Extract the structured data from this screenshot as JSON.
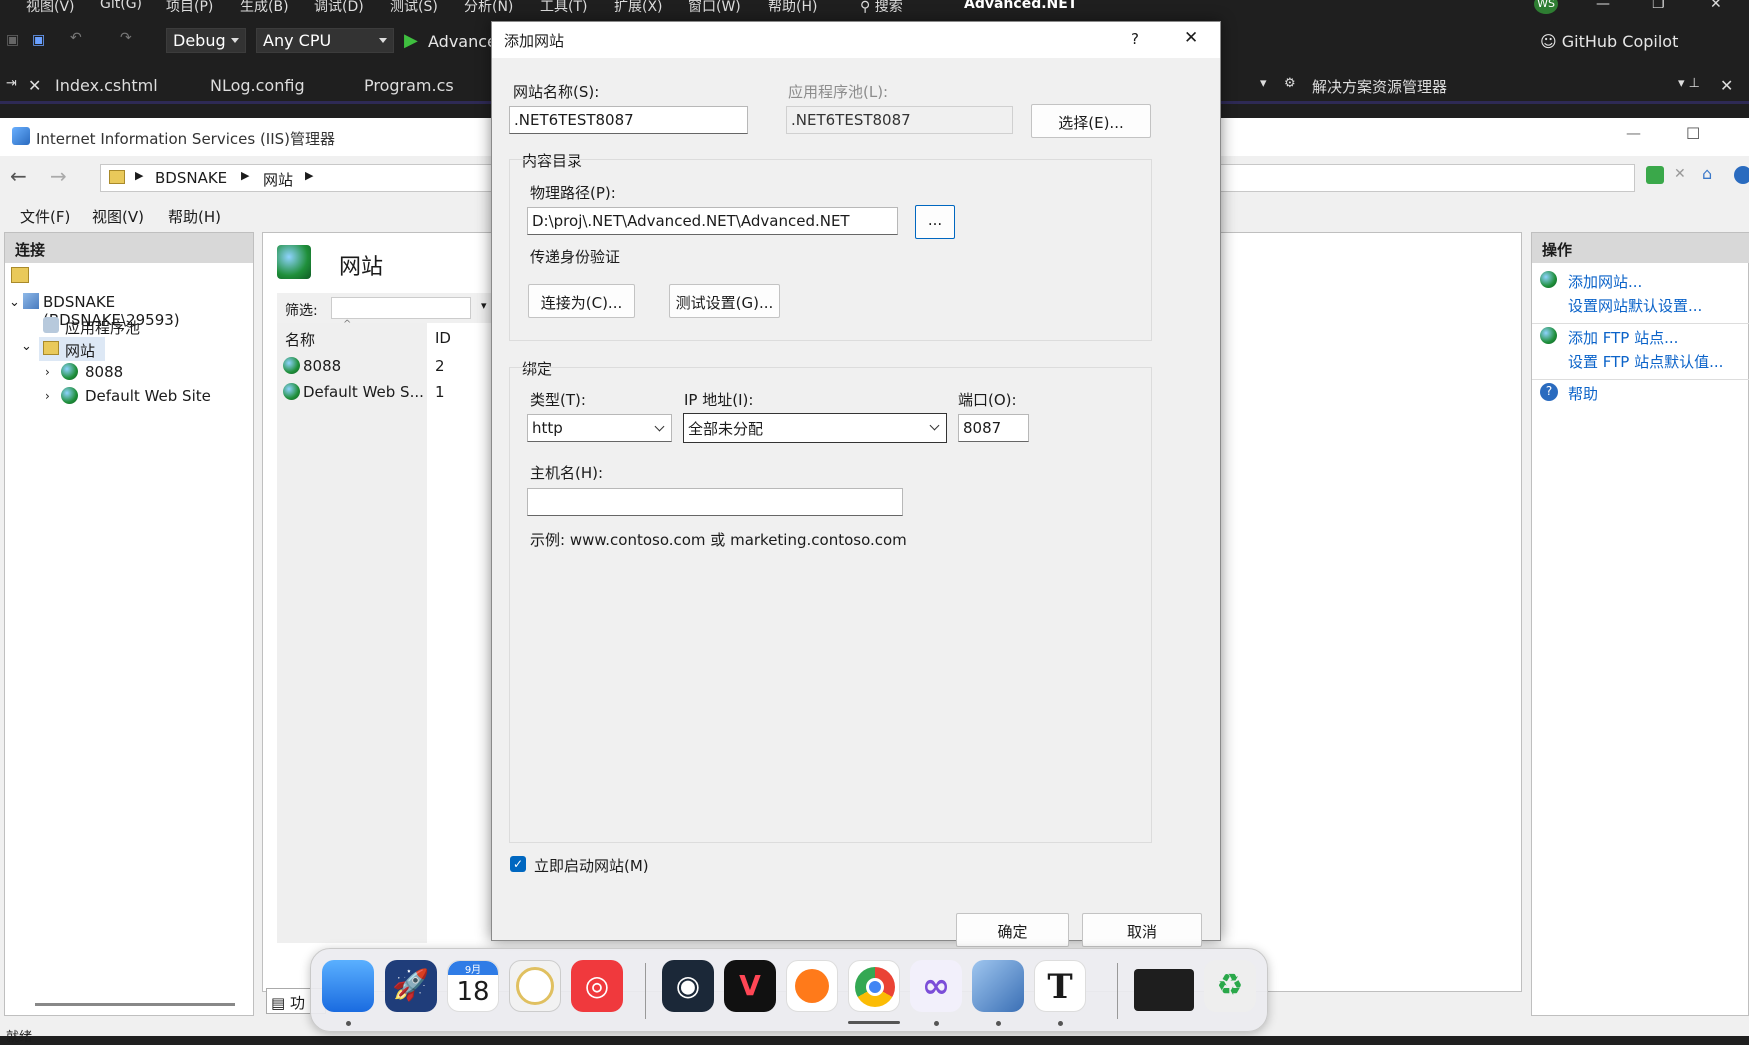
{
  "vs": {
    "menu": [
      "视图(V)",
      "Git(G)",
      "项目(P)",
      "生成(B)",
      "调试(D)",
      "测试(S)",
      "分析(N)",
      "工具(T)",
      "扩展(X)",
      "窗口(W)",
      "帮助(H)"
    ],
    "search": "搜索",
    "project_title": "Advanced.NET",
    "user_initials": "WS",
    "config": "Debug",
    "platform": "Any CPU",
    "run_label": "Advance",
    "copilot": "GitHub Copilot",
    "tabs": [
      "Index.cshtml",
      "NLog.config",
      "Program.cs"
    ],
    "solution_explorer": "解决方案资源管理器"
  },
  "iis": {
    "title": "Internet Information Services (IIS)管理器",
    "breadcrumb": [
      "BDSNAKE",
      "网站"
    ],
    "menu": [
      "文件(F)",
      "视图(V)",
      "帮助(H)"
    ],
    "connections_header": "连接",
    "tree": {
      "server": "BDSNAKE (BDSNAKE\\29593)",
      "app_pools": "应用程序池",
      "sites": "网站",
      "children": [
        "8088",
        "Default Web Site"
      ]
    },
    "page_title": "网站",
    "filter_label": "筛选:",
    "columns": [
      "名称",
      "ID"
    ],
    "rows": [
      {
        "name": "8088",
        "id": "2"
      },
      {
        "name": "Default Web S...",
        "id": "1"
      }
    ],
    "bottom_tab": "功",
    "status": "就绪",
    "actions_header": "操作",
    "actions": [
      "添加网站...",
      "设置网站默认设置...",
      "添加 FTP 站点...",
      "设置 FTP 站点默认值...",
      "帮助"
    ]
  },
  "dialog": {
    "title": "添加网站",
    "help": "?",
    "site_name_label": "网站名称(S):",
    "site_name_value": ".NET6TEST8087",
    "app_pool_label": "应用程序池(L):",
    "app_pool_value": ".NET6TEST8087",
    "select_button": "选择(E)...",
    "content_group": "内容目录",
    "physical_path_label": "物理路径(P):",
    "physical_path_value": "D:\\proj\\.NET\\Advanced.NET\\Advanced.NET",
    "browse_button": "...",
    "passthrough_label": "传递身份验证",
    "connect_as_button": "连接为(C)...",
    "test_settings_button": "测试设置(G)...",
    "binding_group": "绑定",
    "type_label": "类型(T):",
    "type_value": "http",
    "ip_label": "IP 地址(I):",
    "ip_value": "全部未分配",
    "port_label": "端口(O):",
    "port_value": "8087",
    "host_label": "主机名(H):",
    "host_value": "",
    "example": "示例: www.contoso.com 或 marketing.contoso.com",
    "start_now_label": "立即启动网站(M)",
    "start_now_checked": true,
    "ok_button": "确定",
    "cancel_button": "取消"
  },
  "dock": {
    "calendar_month": "9月",
    "calendar_day": "18"
  }
}
